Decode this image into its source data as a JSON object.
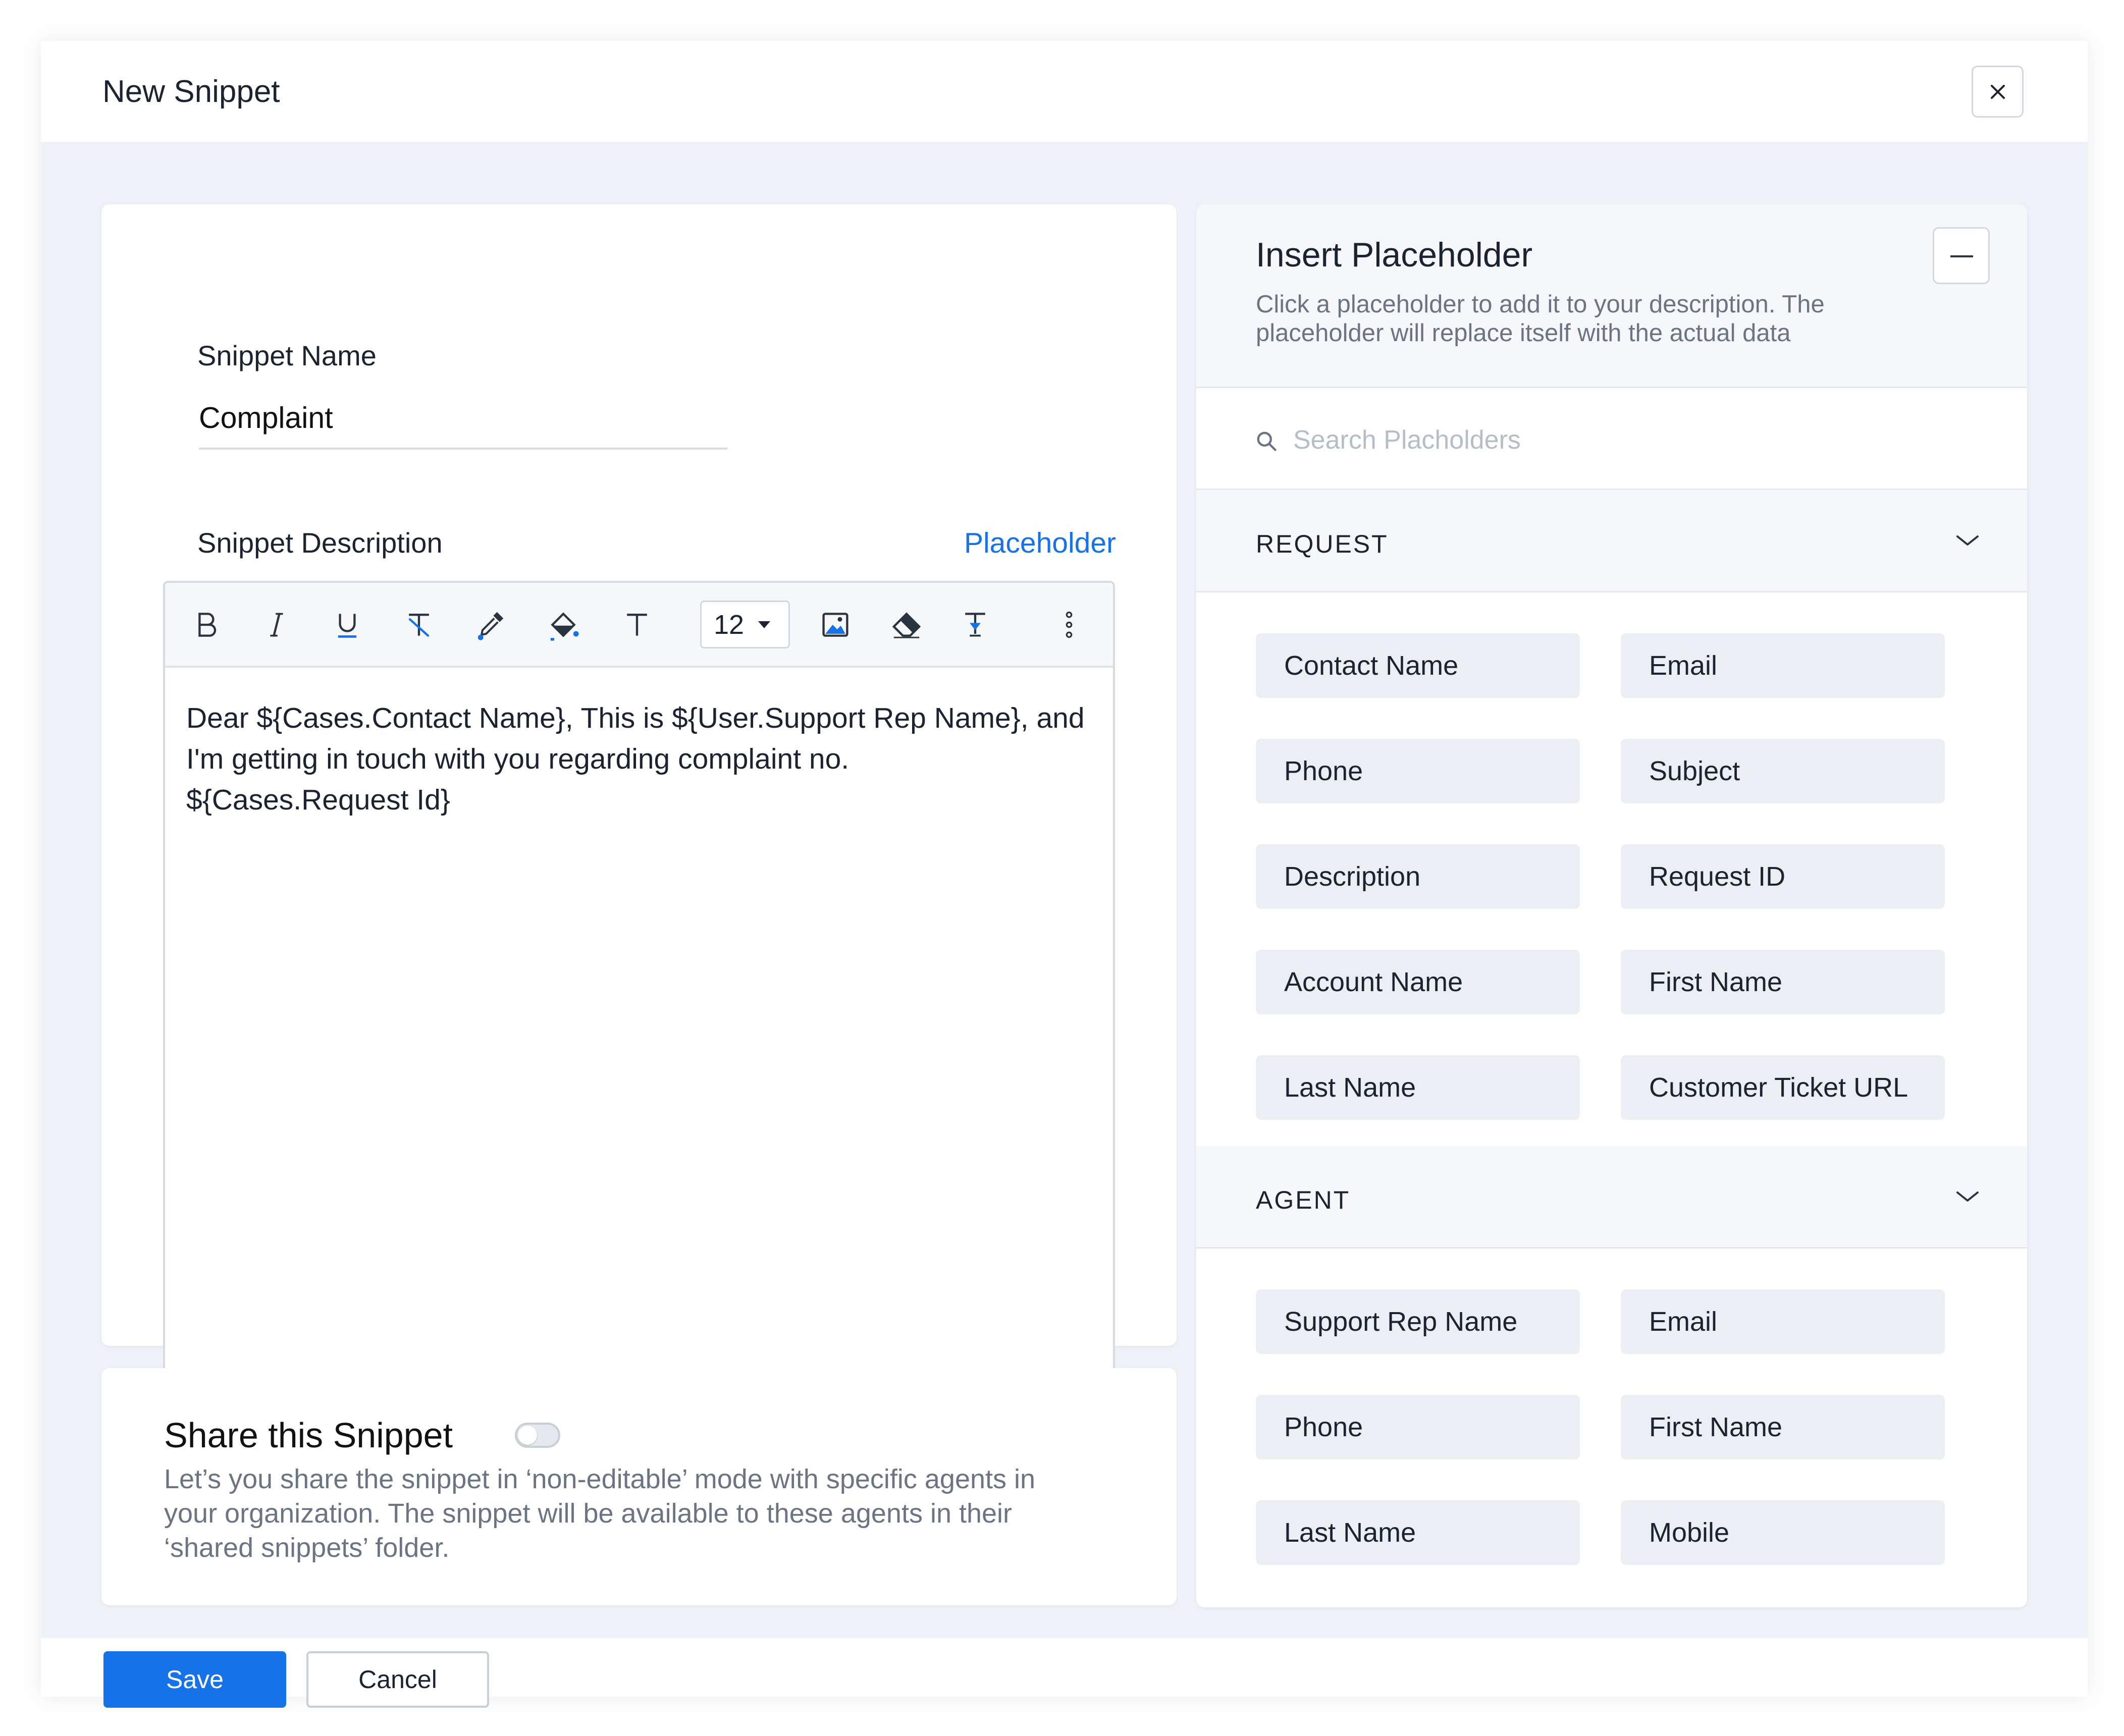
{
  "modal": {
    "title": "New Snippet",
    "close_icon": "close-icon"
  },
  "snippet_name": {
    "label": "Snippet Name",
    "value": "Complaint"
  },
  "snippet_description": {
    "label": "Snippet Description",
    "placeholder_link": "Placeholder",
    "toolbar": {
      "items": [
        "bold-icon",
        "italic-icon",
        "underline-icon",
        "clear-format-icon",
        "text-color-icon",
        "fill-color-icon",
        "font-icon",
        "insert-image-icon",
        "eraser-icon",
        "paste-format-icon",
        "more-vertical-icon"
      ],
      "font_size": "12"
    },
    "lines": [
      "Dear ${Cases.Contact Name}, This is ${User.Support Rep Name}, and",
      "I'm getting in touch with you regarding complaint no.",
      "${Cases.Request Id}"
    ]
  },
  "share": {
    "title": "Share this Snippet",
    "enabled": false,
    "description_lines": [
      "Let’s you share the snippet in ‘non-editable’ mode with specific agents in",
      "your organization. The snippet will be available to these agents in their",
      "‘shared snippets’ folder."
    ]
  },
  "placeholder_panel": {
    "title": "Insert Placeholder",
    "subtitle_lines": [
      "Click a placeholder to add it to your description. The",
      "placeholder will replace itself with the actual data"
    ],
    "search_placeholder": "Search Placholders",
    "sections": [
      {
        "name": "REQUEST",
        "chips": [
          "Contact Name",
          "Email",
          "Phone",
          "Subject",
          "Description",
          "Request ID",
          "Account Name",
          "First Name",
          "Last Name",
          "Customer Ticket URL"
        ]
      },
      {
        "name": "AGENT",
        "chips": [
          "Support Rep Name",
          "Email",
          "Phone",
          "First Name",
          "Last Name",
          "Mobile"
        ]
      }
    ]
  },
  "footer": {
    "save_label": "Save",
    "cancel_label": "Cancel"
  },
  "colors": {
    "accent": "#1572e8",
    "background": "#eef1f5",
    "chip": "#ebeef2"
  }
}
